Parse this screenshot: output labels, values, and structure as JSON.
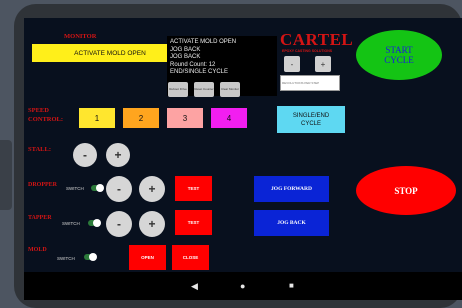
{
  "monitor": {
    "label": "MONITOR",
    "status_text": "ACTIVATE MOLD OPEN",
    "log_lines": [
      "ACTIVATE MOLD OPEN",
      "JOG BACK",
      "JOG BACK",
      "Round Count: 12",
      "END/SINGLE CYCLE"
    ],
    "small_buttons": [
      "Reboot Drive",
      "Reset Counter",
      "Clear Monitor"
    ]
  },
  "brand": {
    "logo_text": "CARTEL",
    "tagline": "EPOXY CASTING SOLUTIONS",
    "minus_label": "-",
    "plus_label": "+",
    "input_placeholder": "REVOLUTIONS PER STEP",
    "logo_color": "#d41414"
  },
  "start_cycle": {
    "label": "START\nCYCLE",
    "color": "#14c414"
  },
  "speed": {
    "label": "SPEED\nCONTROL:",
    "buttons": [
      {
        "label": "1",
        "color": "#ffe62e"
      },
      {
        "label": "2",
        "color": "#ffa51e"
      },
      {
        "label": "3",
        "color": "#fda3a3"
      },
      {
        "label": "4",
        "color": "#f21ef0"
      }
    ],
    "single_end_label": "SINGLE/END\nCYCLE",
    "single_end_color": "#5ed8f2"
  },
  "stall": {
    "label": "STALL:",
    "minus": "-",
    "plus": "+"
  },
  "dropper": {
    "label": "DROPPER",
    "switch_label": "SWITCH",
    "minus": "-",
    "plus": "+",
    "test_label": "TEST"
  },
  "tapper": {
    "label": "TAPPER",
    "switch_label": "SWITCH",
    "minus": "-",
    "plus": "+",
    "test_label": "TEST"
  },
  "mold": {
    "label": "MOLD",
    "switch_label": "SWITCH",
    "open_label": "OPEN",
    "close_label": "CLOSE"
  },
  "jog": {
    "forward_label": "JOG FORWARD",
    "back_label": "JOG BACK"
  },
  "stop": {
    "label": "STOP",
    "color": "#ff0000"
  },
  "navbar": {
    "back": "◀",
    "home": "●",
    "recents": "■"
  }
}
